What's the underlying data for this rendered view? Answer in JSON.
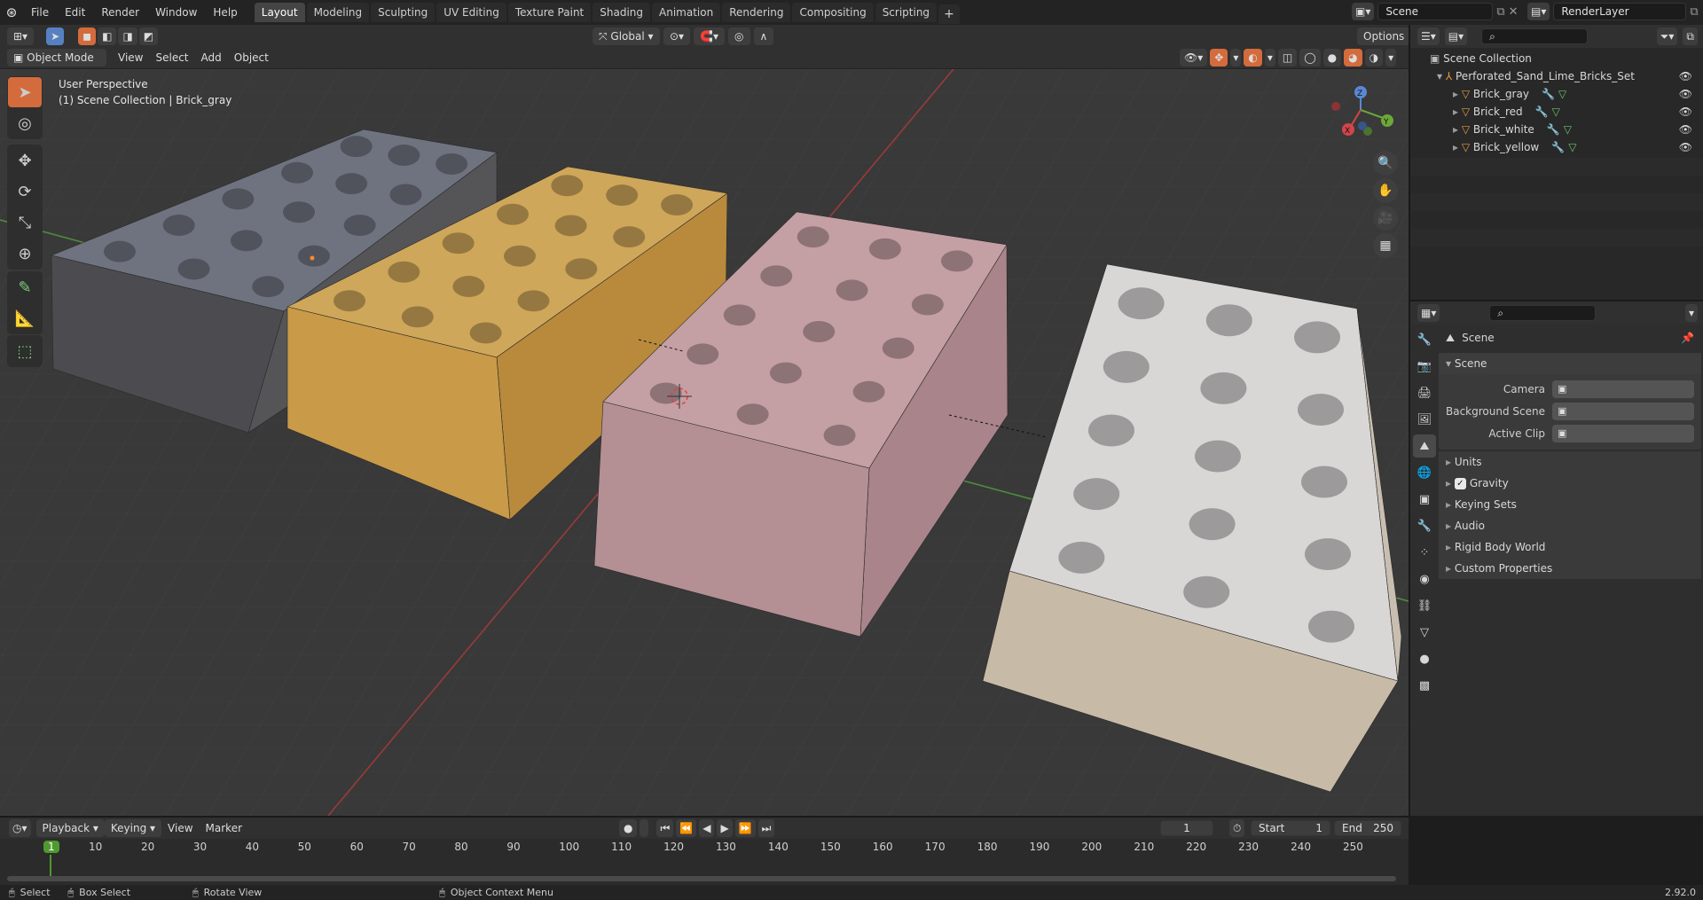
{
  "app": {
    "name": "Blender",
    "version": "2.92.0"
  },
  "topbar": {
    "menus": [
      "File",
      "Edit",
      "Render",
      "Window",
      "Help"
    ],
    "workspaces": [
      "Layout",
      "Modeling",
      "Sculpting",
      "UV Editing",
      "Texture Paint",
      "Shading",
      "Animation",
      "Rendering",
      "Compositing",
      "Scripting"
    ],
    "active_workspace": "Layout",
    "scene_name": "Scene",
    "view_layer": "RenderLayer"
  },
  "viewport_header": {
    "mode": "Object Mode",
    "menus": [
      "View",
      "Select",
      "Add",
      "Object"
    ],
    "transform_orientation": "Global",
    "options_label": "Options"
  },
  "viewport": {
    "perspective_label": "User Perspective",
    "context_label": "(1) Scene Collection | Brick_gray",
    "bricks": [
      {
        "name": "Brick_gray",
        "top": "#6f7380",
        "side": "#555558",
        "front": "#4c4c50"
      },
      {
        "name": "Brick_yellow",
        "top": "#cfa75a",
        "side": "#b98a3c",
        "front": "#c99a48"
      },
      {
        "name": "Brick_red",
        "top": "#c49fa4",
        "side": "#a9848a",
        "front": "#b48f94"
      },
      {
        "name": "Brick_white",
        "top": "#d9d6d6",
        "side": "#c9bfb1",
        "front": "#c7bba8"
      }
    ],
    "gizmo_axes": [
      "X",
      "Y",
      "Z"
    ]
  },
  "outliner": {
    "search_placeholder": "",
    "root": "Scene Collection",
    "collection": "Perforated_Sand_Lime_Bricks_Set",
    "objects": [
      "Brick_gray",
      "Brick_red",
      "Brick_white",
      "Brick_yellow"
    ]
  },
  "properties": {
    "context": "Scene",
    "panel_title": "Scene",
    "fields": [
      {
        "label": "Camera",
        "value": ""
      },
      {
        "label": "Background Scene",
        "value": ""
      },
      {
        "label": "Active Clip",
        "value": ""
      }
    ],
    "collapsed_panels": [
      "Units",
      "Gravity",
      "Keying Sets",
      "Audio",
      "Rigid Body World",
      "Custom Properties"
    ],
    "gravity_checked": true
  },
  "timeline": {
    "menus": [
      "Playback",
      "Keying",
      "View",
      "Marker"
    ],
    "current_frame": "1",
    "start_label": "Start",
    "start": "1",
    "end_label": "End",
    "end": "250",
    "ticks": [
      "1",
      "10",
      "20",
      "30",
      "40",
      "50",
      "60",
      "70",
      "80",
      "90",
      "100",
      "110",
      "120",
      "130",
      "140",
      "150",
      "160",
      "170",
      "180",
      "190",
      "200",
      "210",
      "220",
      "230",
      "240",
      "250"
    ]
  },
  "statusbar": {
    "select": "Select",
    "box_select": "Box Select",
    "rotate_view": "Rotate View",
    "context_menu": "Object Context Menu",
    "version": "2.92.0"
  }
}
